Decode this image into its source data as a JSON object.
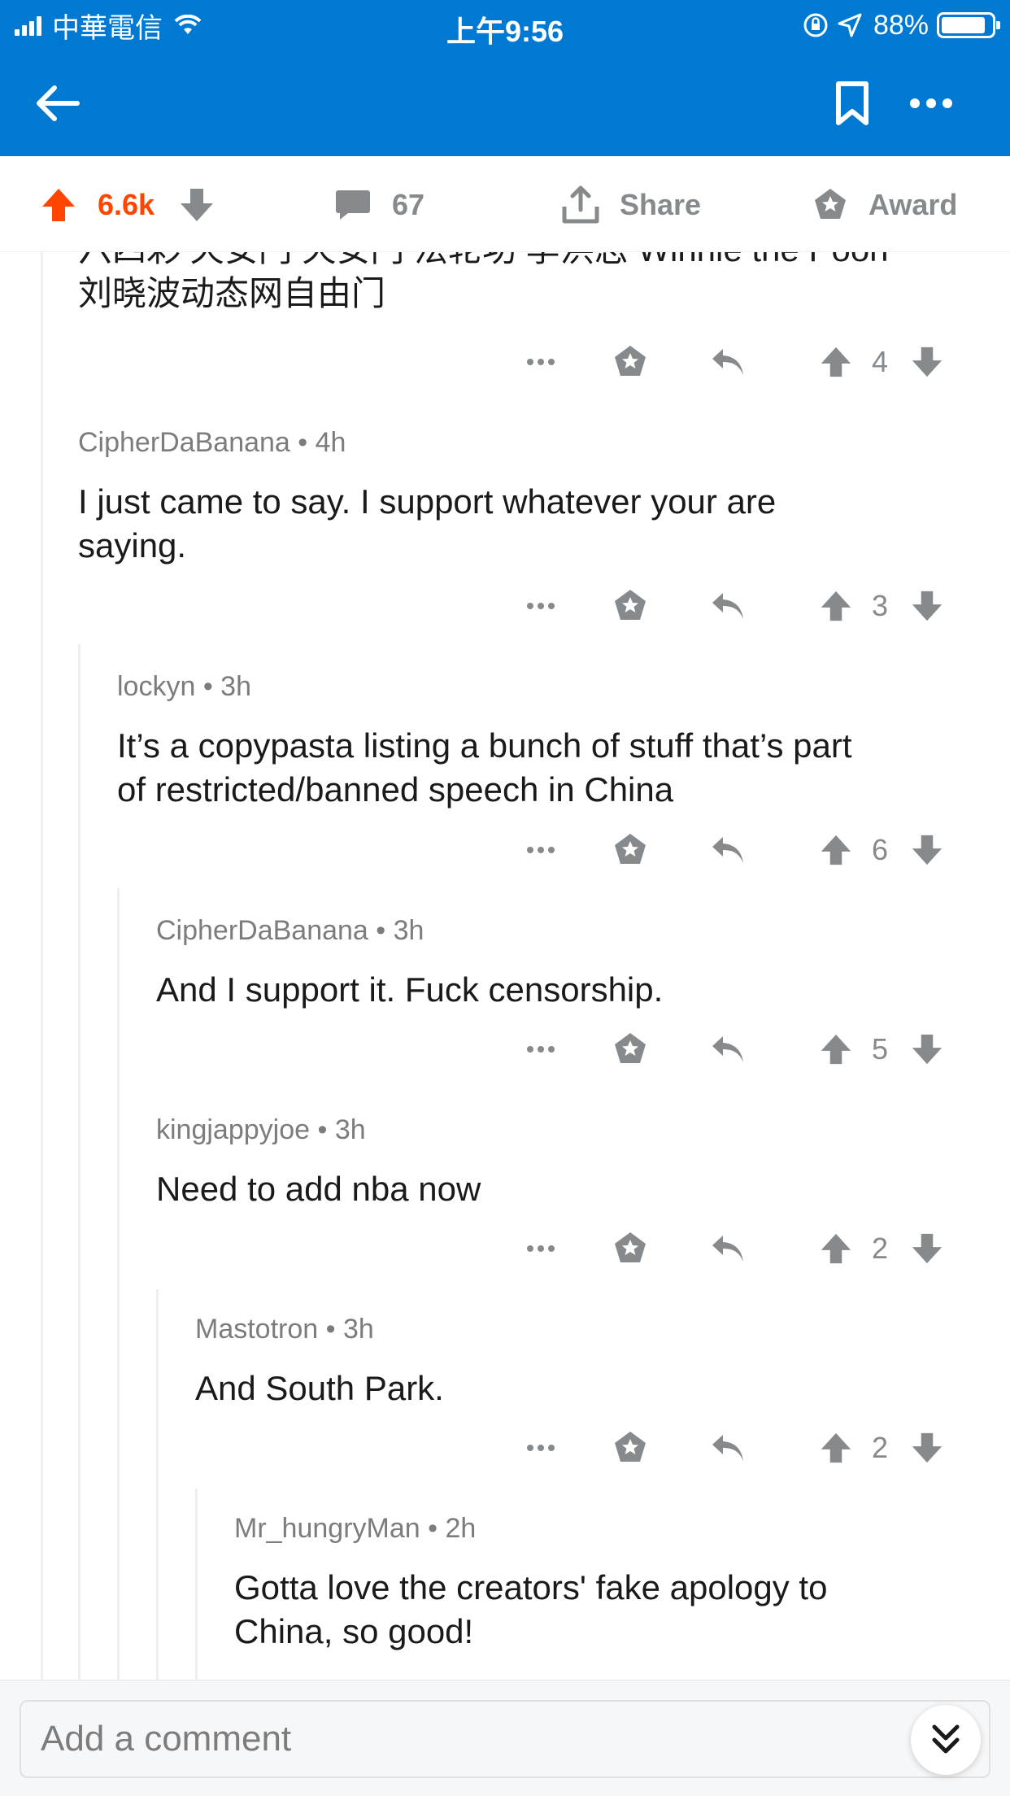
{
  "status_bar": {
    "carrier": "中華電信",
    "time": "上午9:56",
    "battery": "88%",
    "battery_level": 0.88
  },
  "nav": {
    "back_icon": "arrow-left-icon",
    "bookmark_icon": "bookmark-icon",
    "more_icon": "more-horizontal-icon"
  },
  "post_actions": {
    "score": "6.6k",
    "comment_count": "67",
    "share_label": "Share",
    "award_label": "Award"
  },
  "comments": [
    {
      "author": "",
      "time": "",
      "body_lines": [
        "六四彩 天安门 天安门 法轮功 李洪志 Winnie the Pooh",
        "刘晓波动态网自由门"
      ],
      "votes": "4"
    },
    {
      "author": "CipherDaBanana",
      "time": "4h",
      "body_lines": [
        "I just came to say.  I support whatever your are",
        "saying."
      ],
      "votes": "3"
    },
    {
      "author": "lockyn",
      "time": "3h",
      "body_lines": [
        "It’s a copypasta listing a bunch of stuff that’s part",
        "of restricted/banned speech in China"
      ],
      "votes": "6"
    },
    {
      "author": "CipherDaBanana",
      "time": "3h",
      "body_lines": [
        "And I support it.  Fuck censorship."
      ],
      "votes": "5"
    },
    {
      "author": "kingjappyjoe",
      "time": "3h",
      "body_lines": [
        "Need to add nba now"
      ],
      "votes": "2"
    },
    {
      "author": "Mastotron",
      "time": "3h",
      "body_lines": [
        "And South Park."
      ],
      "votes": "2"
    },
    {
      "author": "Mr_hungryMan",
      "time": "2h",
      "body_lines": [
        "Gotta love the creators' fake apology to",
        "China, so good!"
      ],
      "votes": ""
    }
  ],
  "composer": {
    "placeholder": "Add a comment",
    "jump_icon": "double-chevron-down-icon"
  },
  "colors": {
    "brand_blue": "#0079d3",
    "upvote_orange": "#ff4500",
    "icon_gray": "#878a8c"
  }
}
